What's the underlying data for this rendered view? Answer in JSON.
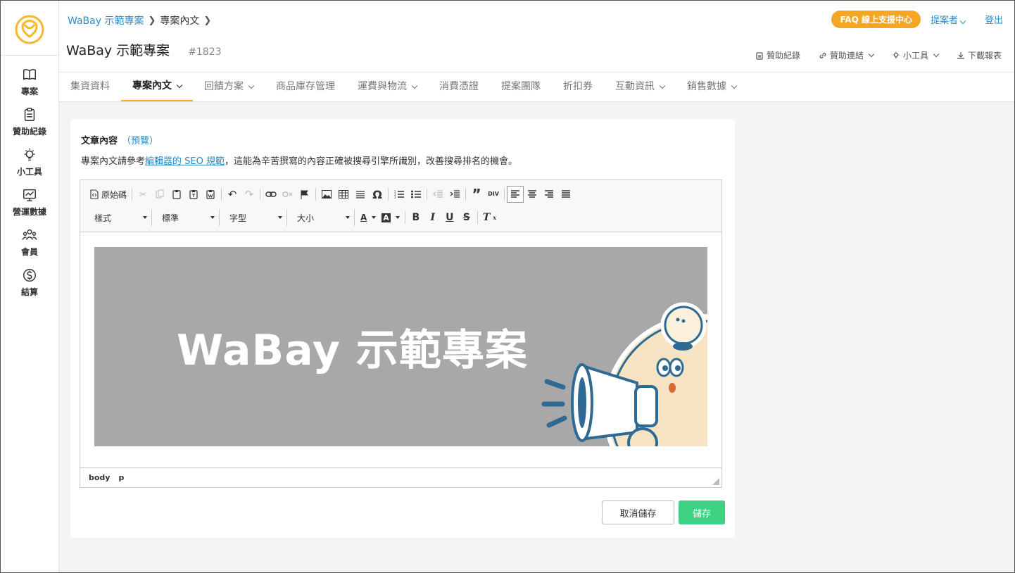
{
  "breadcrumb": {
    "project_link": "WaBay 示範專案",
    "current": "專案內文"
  },
  "header": {
    "title": "WaBay 示範專案",
    "project_id": "#1823"
  },
  "topbar": {
    "faq": "FAQ 線上支援中心",
    "proposer": "提案者",
    "logout": "登出"
  },
  "actions": {
    "sponsor_records": "贊助紀錄",
    "sponsor_links": "贊助連結",
    "tools": "小工具",
    "download": "下載報表"
  },
  "sidebar": {
    "items": [
      {
        "label": "專案",
        "icon": "book-icon"
      },
      {
        "label": "贊助紀錄",
        "icon": "clipboard-icon"
      },
      {
        "label": "小工具",
        "icon": "lightbulb-icon"
      },
      {
        "label": "營運數據",
        "icon": "chart-icon"
      },
      {
        "label": "會員",
        "icon": "members-icon"
      },
      {
        "label": "結算",
        "icon": "dollar-icon"
      }
    ]
  },
  "tabs": [
    {
      "label": "集資資料"
    },
    {
      "label": "專案內文"
    },
    {
      "label": "回饋方案"
    },
    {
      "label": "商品庫存管理"
    },
    {
      "label": "運費與物流"
    },
    {
      "label": "消費憑證"
    },
    {
      "label": "提案團隊"
    },
    {
      "label": "折扣券"
    },
    {
      "label": "互動資訊"
    },
    {
      "label": "銷售數據"
    }
  ],
  "card": {
    "title": "文章內容",
    "preview": "（預覽）",
    "desc_prefix": "專案內文請參考",
    "desc_link": "編輯器的 SEO 規範",
    "desc_suffix": "，這能為辛苦撰寫的內容正確被搜尋引擎所識別，改善搜尋排名的機會。"
  },
  "editor": {
    "source_label": "原始碼",
    "styles": "樣式",
    "format": "標準",
    "font": "字型",
    "size": "大小",
    "banner_text": "WaBay 示範專案",
    "status_path": [
      "body",
      "p"
    ]
  },
  "buttons": {
    "cancel": "取消儲存",
    "save": "儲存"
  },
  "colors": {
    "accent": "#f5a623",
    "link": "#2a8bc7",
    "save": "#3dd184"
  }
}
